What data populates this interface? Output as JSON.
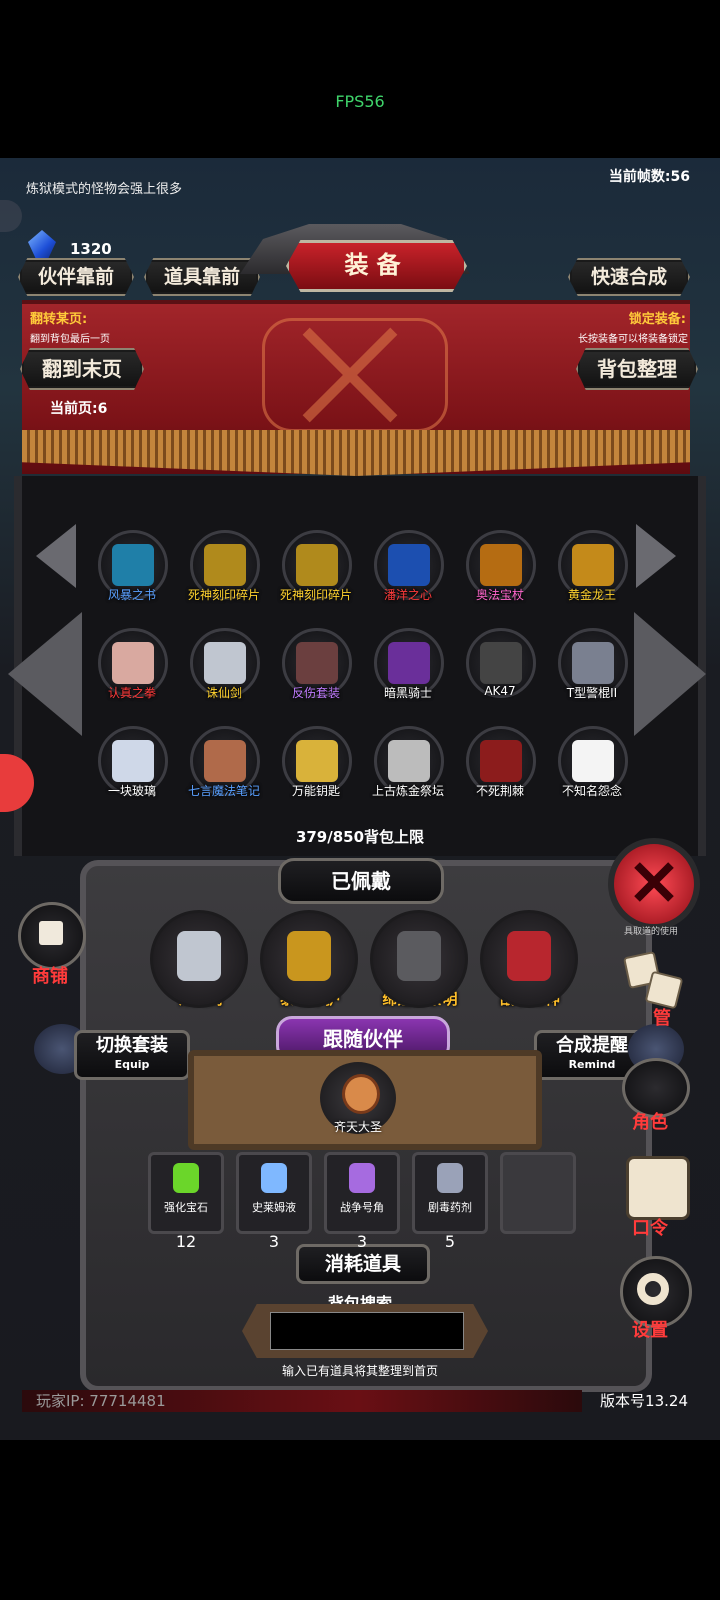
{
  "status": {
    "fps": "FPS56"
  },
  "hud": {
    "hint": "炼狱模式的怪物会强上很多",
    "frame_count": "当前帧数:56",
    "gem_count": "1320"
  },
  "header": {
    "title": "装备",
    "partner_front": "伙伴靠前",
    "item_front": "道具靠前",
    "quick_merge": "快速合成",
    "flip_title": "翻转某页:",
    "flip_desc": "翻到背包最后一页",
    "lock_title": "锁定装备:",
    "lock_desc": "长按装备可以将装备锁定",
    "to_last_page": "翻到末页",
    "sort_bag": "背包整理",
    "current_page": "当前页:6"
  },
  "inventory": [
    {
      "label": "风暴之书",
      "color": "#5aa0ff",
      "icon": "book-icon"
    },
    {
      "label": "死神刻印碎片",
      "color": "#ffd22e",
      "icon": "seal-icon"
    },
    {
      "label": "死神刻印碎片",
      "color": "#ffd22e",
      "icon": "seal-icon"
    },
    {
      "label": "潘洋之心",
      "color": "#ff3b3b",
      "icon": "heart-orb-icon"
    },
    {
      "label": "奥法宝杖",
      "color": "#ff66cc",
      "icon": "staff-icon"
    },
    {
      "label": "黄金龙王",
      "color": "#ffd22e",
      "icon": "dragon-icon"
    },
    {
      "label": "认真之拳",
      "color": "#ff3b3b",
      "icon": "fist-icon"
    },
    {
      "label": "诛仙剑",
      "color": "#ffd22e",
      "icon": "sword-icon"
    },
    {
      "label": "反伤套装",
      "color": "#c07bff",
      "icon": "armor-icon"
    },
    {
      "label": "暗黑骑士",
      "color": "#ffffff",
      "icon": "dark-knight-icon"
    },
    {
      "label": "AK47",
      "color": "#ffffff",
      "icon": "rifle-icon"
    },
    {
      "label": "T型警棍II",
      "color": "#ffffff",
      "icon": "baton-icon"
    },
    {
      "label": "一块玻璃",
      "color": "#ffffff",
      "icon": "glass-icon"
    },
    {
      "label": "七言魔法笔记",
      "color": "#5aa0ff",
      "icon": "notebook-icon"
    },
    {
      "label": "万能钥匙",
      "color": "#ffffff",
      "icon": "key-icon"
    },
    {
      "label": "上古炼金祭坛",
      "color": "#ffffff",
      "icon": "altar-icon"
    },
    {
      "label": "不死荆棘",
      "color": "#ffffff",
      "icon": "thorn-wreath-icon"
    },
    {
      "label": "不知名怨念",
      "color": "#ffffff",
      "icon": "ghost-icon"
    }
  ],
  "bag_capacity": "379/850背包上限",
  "equipped": {
    "title": "已佩戴",
    "items": [
      {
        "label": "诛仙剑",
        "icon": "sword-icon"
      },
      {
        "label": "泰坦守护",
        "icon": "titan-armor-icon"
      },
      {
        "label": "缔造者黎明",
        "icon": "greatsword-icon"
      },
      {
        "label": "战争之神",
        "icon": "war-god-icon"
      }
    ]
  },
  "partner": {
    "title": "跟随伙伴",
    "switch_set": "切换套装",
    "switch_set_sub": "Equip",
    "merge_remind": "合成提醒",
    "merge_remind_sub": "Remind",
    "name": "齐天大圣"
  },
  "consumables": {
    "title": "消耗道具",
    "items": [
      {
        "label": "强化宝石",
        "count": "12",
        "icon": "green-gem-icon"
      },
      {
        "label": "史莱姆液",
        "count": "3",
        "icon": "potion-icon"
      },
      {
        "label": "战争号角",
        "count": "3",
        "icon": "horn-icon"
      },
      {
        "label": "剧毒药剂",
        "count": "5",
        "icon": "poison-icon"
      }
    ]
  },
  "search": {
    "title": "背包搜索",
    "hint": "输入已有道具将其整理到首页",
    "value": ""
  },
  "side": {
    "shop": "商铺",
    "dice_label": "管",
    "role": "角色",
    "code": "口令",
    "settings": "设置",
    "close_hint": "具取道的使用"
  },
  "footer": {
    "player_ip": "玩家IP: 77714481",
    "version": "版本号13.24"
  }
}
